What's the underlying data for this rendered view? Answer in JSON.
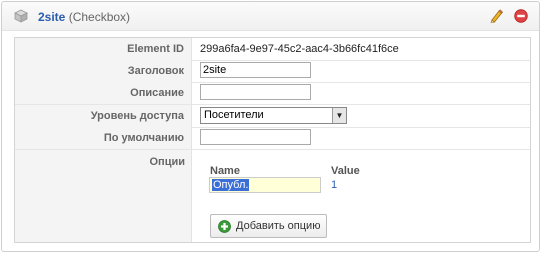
{
  "header": {
    "title": "2site",
    "subtitle": "(Checkbox)"
  },
  "fields": {
    "element_id": {
      "label": "Element ID",
      "value": "299a6fa4-9e97-45c2-aac4-3b66fc41f6ce"
    },
    "title": {
      "label": "Заголовок",
      "value": "2site"
    },
    "description": {
      "label": "Описание",
      "value": ""
    },
    "access": {
      "label": "Уровень доступа",
      "selected": "Посетители"
    },
    "default": {
      "label": "По умолчанию",
      "value": ""
    }
  },
  "options": {
    "label": "Опции",
    "col_name": "Name",
    "col_value": "Value",
    "rows": [
      {
        "name": "Опубл.",
        "value": "1"
      }
    ],
    "add_button": "Добавить опцию"
  },
  "icons": {
    "edit": "pencil-icon",
    "delete": "minus-circle-icon",
    "type": "cube-icon",
    "add": "plus-circle-icon"
  },
  "colors": {
    "title": "#2a5db0",
    "delete": "#e04343",
    "add": "#3a9a3a",
    "highlight": "#3b6fd8"
  }
}
